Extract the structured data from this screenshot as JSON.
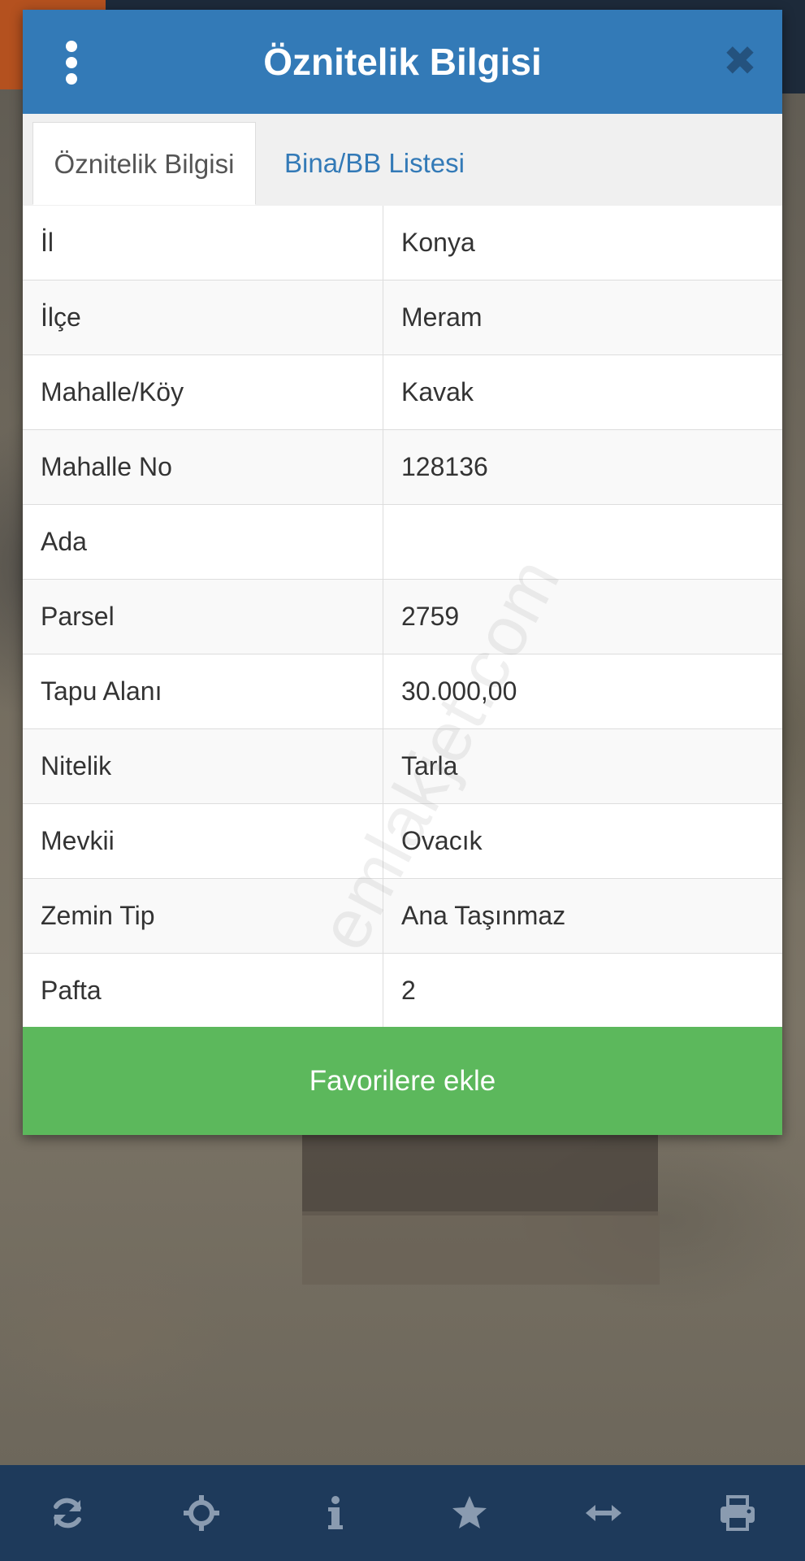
{
  "dialog": {
    "title": "Öznitelik Bilgisi",
    "menu_icon": "kebab-menu-icon",
    "close_glyph": "✖"
  },
  "tabs": [
    {
      "label": "Öznitelik Bilgisi",
      "active": true
    },
    {
      "label": "Bina/BB Listesi",
      "active": false
    }
  ],
  "attributes": [
    {
      "key": "İl",
      "value": "Konya"
    },
    {
      "key": "İlçe",
      "value": "Meram"
    },
    {
      "key": "Mahalle/Köy",
      "value": "Kavak"
    },
    {
      "key": "Mahalle No",
      "value": "128136"
    },
    {
      "key": "Ada",
      "value": ""
    },
    {
      "key": "Parsel",
      "value": "2759"
    },
    {
      "key": "Tapu Alanı",
      "value": "30.000,00"
    },
    {
      "key": "Nitelik",
      "value": "Tarla"
    },
    {
      "key": "Mevkii",
      "value": "Ovacık"
    },
    {
      "key": "Zemin Tip",
      "value": "Ana Taşınmaz"
    },
    {
      "key": "Pafta",
      "value": "2"
    }
  ],
  "favorite_button": "Favorilere ekle",
  "watermark": "emlakjet.com",
  "bottom_nav": [
    "refresh-icon",
    "locate-icon",
    "info-icon",
    "star-icon",
    "measure-icon",
    "print-icon"
  ],
  "colors": {
    "header": "#337ab7",
    "favorite": "#5cb85c",
    "bottom_nav": "#1e3a5b",
    "nav_icon": "#8a9bb0"
  }
}
